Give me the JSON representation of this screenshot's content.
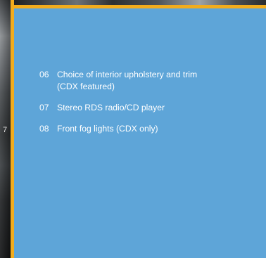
{
  "side_photo": {
    "label": "7"
  },
  "features": [
    {
      "number": "06",
      "text": "Choice of interior upholstery and trim",
      "note": "(CDX featured)"
    },
    {
      "number": "07",
      "text": "Stereo RDS radio/CD player",
      "note": ""
    },
    {
      "number": "08",
      "text": "Front fog lights (CDX only)",
      "note": ""
    }
  ],
  "colors": {
    "panel": "#5ea5d8",
    "frame": "#f2ac1d",
    "text": "#ffffff"
  }
}
